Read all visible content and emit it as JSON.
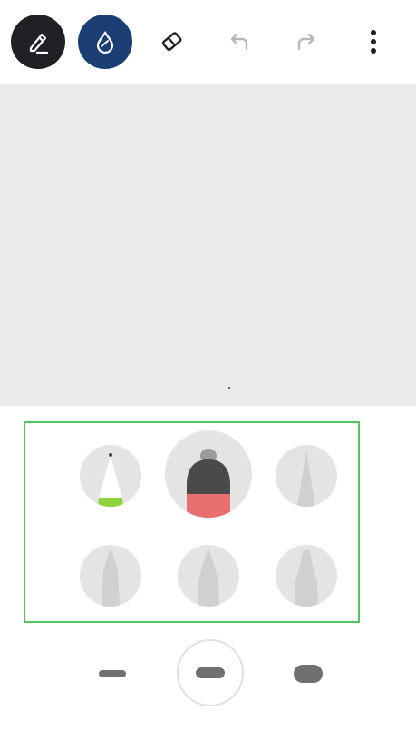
{
  "toolbar": {
    "tools": [
      {
        "icon": "pen-icon",
        "state": "active"
      },
      {
        "icon": "ink-drop-icon",
        "state": "active-accent"
      },
      {
        "icon": "eraser-icon",
        "state": "normal"
      },
      {
        "icon": "undo-icon",
        "state": "disabled"
      },
      {
        "icon": "redo-icon",
        "state": "disabled"
      },
      {
        "icon": "more-vertical-icon",
        "state": "normal"
      }
    ]
  },
  "colors": {
    "active_tool_bg": "#202124",
    "accent_tool_bg": "#1b3e73",
    "canvas_bg": "#ebebeb",
    "picker_border": "#52c55a",
    "selected_pen_tip": "#e87070",
    "pencil_tip": "#8fd33a"
  },
  "pen_picker": {
    "pens": [
      {
        "icon": "pencil-icon",
        "selected": false
      },
      {
        "icon": "marker-icon",
        "selected": true
      },
      {
        "icon": "fine-pen-icon",
        "selected": false
      },
      {
        "icon": "calligraphy-pen-icon",
        "selected": false
      },
      {
        "icon": "brush-pen-icon",
        "selected": false
      },
      {
        "icon": "chisel-pen-icon",
        "selected": false
      }
    ]
  },
  "stroke_sizes": [
    {
      "name": "thin",
      "selected": false
    },
    {
      "name": "medium",
      "selected": true
    },
    {
      "name": "thick",
      "selected": false
    }
  ]
}
